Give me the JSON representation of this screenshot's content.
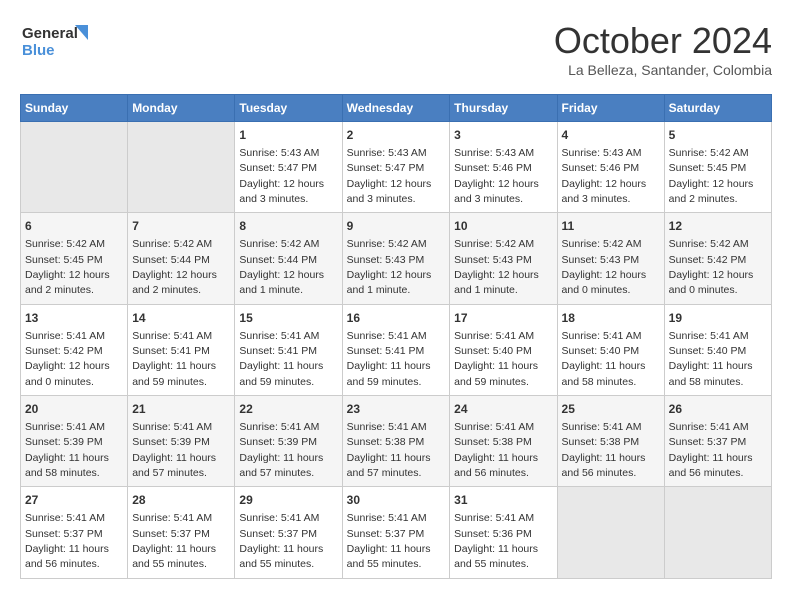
{
  "header": {
    "logo_line1": "General",
    "logo_line2": "Blue",
    "month": "October 2024",
    "location": "La Belleza, Santander, Colombia"
  },
  "days_of_week": [
    "Sunday",
    "Monday",
    "Tuesday",
    "Wednesday",
    "Thursday",
    "Friday",
    "Saturday"
  ],
  "weeks": [
    [
      {
        "day": "",
        "empty": true
      },
      {
        "day": "",
        "empty": true
      },
      {
        "day": "1",
        "sunrise": "5:43 AM",
        "sunset": "5:47 PM",
        "daylight": "12 hours and 3 minutes."
      },
      {
        "day": "2",
        "sunrise": "5:43 AM",
        "sunset": "5:47 PM",
        "daylight": "12 hours and 3 minutes."
      },
      {
        "day": "3",
        "sunrise": "5:43 AM",
        "sunset": "5:46 PM",
        "daylight": "12 hours and 3 minutes."
      },
      {
        "day": "4",
        "sunrise": "5:43 AM",
        "sunset": "5:46 PM",
        "daylight": "12 hours and 3 minutes."
      },
      {
        "day": "5",
        "sunrise": "5:42 AM",
        "sunset": "5:45 PM",
        "daylight": "12 hours and 2 minutes."
      }
    ],
    [
      {
        "day": "6",
        "sunrise": "5:42 AM",
        "sunset": "5:45 PM",
        "daylight": "12 hours and 2 minutes."
      },
      {
        "day": "7",
        "sunrise": "5:42 AM",
        "sunset": "5:44 PM",
        "daylight": "12 hours and 2 minutes."
      },
      {
        "day": "8",
        "sunrise": "5:42 AM",
        "sunset": "5:44 PM",
        "daylight": "12 hours and 1 minute."
      },
      {
        "day": "9",
        "sunrise": "5:42 AM",
        "sunset": "5:43 PM",
        "daylight": "12 hours and 1 minute."
      },
      {
        "day": "10",
        "sunrise": "5:42 AM",
        "sunset": "5:43 PM",
        "daylight": "12 hours and 1 minute."
      },
      {
        "day": "11",
        "sunrise": "5:42 AM",
        "sunset": "5:43 PM",
        "daylight": "12 hours and 0 minutes."
      },
      {
        "day": "12",
        "sunrise": "5:42 AM",
        "sunset": "5:42 PM",
        "daylight": "12 hours and 0 minutes."
      }
    ],
    [
      {
        "day": "13",
        "sunrise": "5:41 AM",
        "sunset": "5:42 PM",
        "daylight": "12 hours and 0 minutes."
      },
      {
        "day": "14",
        "sunrise": "5:41 AM",
        "sunset": "5:41 PM",
        "daylight": "11 hours and 59 minutes."
      },
      {
        "day": "15",
        "sunrise": "5:41 AM",
        "sunset": "5:41 PM",
        "daylight": "11 hours and 59 minutes."
      },
      {
        "day": "16",
        "sunrise": "5:41 AM",
        "sunset": "5:41 PM",
        "daylight": "11 hours and 59 minutes."
      },
      {
        "day": "17",
        "sunrise": "5:41 AM",
        "sunset": "5:40 PM",
        "daylight": "11 hours and 59 minutes."
      },
      {
        "day": "18",
        "sunrise": "5:41 AM",
        "sunset": "5:40 PM",
        "daylight": "11 hours and 58 minutes."
      },
      {
        "day": "19",
        "sunrise": "5:41 AM",
        "sunset": "5:40 PM",
        "daylight": "11 hours and 58 minutes."
      }
    ],
    [
      {
        "day": "20",
        "sunrise": "5:41 AM",
        "sunset": "5:39 PM",
        "daylight": "11 hours and 58 minutes."
      },
      {
        "day": "21",
        "sunrise": "5:41 AM",
        "sunset": "5:39 PM",
        "daylight": "11 hours and 57 minutes."
      },
      {
        "day": "22",
        "sunrise": "5:41 AM",
        "sunset": "5:39 PM",
        "daylight": "11 hours and 57 minutes."
      },
      {
        "day": "23",
        "sunrise": "5:41 AM",
        "sunset": "5:38 PM",
        "daylight": "11 hours and 57 minutes."
      },
      {
        "day": "24",
        "sunrise": "5:41 AM",
        "sunset": "5:38 PM",
        "daylight": "11 hours and 56 minutes."
      },
      {
        "day": "25",
        "sunrise": "5:41 AM",
        "sunset": "5:38 PM",
        "daylight": "11 hours and 56 minutes."
      },
      {
        "day": "26",
        "sunrise": "5:41 AM",
        "sunset": "5:37 PM",
        "daylight": "11 hours and 56 minutes."
      }
    ],
    [
      {
        "day": "27",
        "sunrise": "5:41 AM",
        "sunset": "5:37 PM",
        "daylight": "11 hours and 56 minutes."
      },
      {
        "day": "28",
        "sunrise": "5:41 AM",
        "sunset": "5:37 PM",
        "daylight": "11 hours and 55 minutes."
      },
      {
        "day": "29",
        "sunrise": "5:41 AM",
        "sunset": "5:37 PM",
        "daylight": "11 hours and 55 minutes."
      },
      {
        "day": "30",
        "sunrise": "5:41 AM",
        "sunset": "5:37 PM",
        "daylight": "11 hours and 55 minutes."
      },
      {
        "day": "31",
        "sunrise": "5:41 AM",
        "sunset": "5:36 PM",
        "daylight": "11 hours and 55 minutes."
      },
      {
        "day": "",
        "empty": true
      },
      {
        "day": "",
        "empty": true
      }
    ]
  ],
  "labels": {
    "sunrise": "Sunrise:",
    "sunset": "Sunset:",
    "daylight": "Daylight:"
  }
}
